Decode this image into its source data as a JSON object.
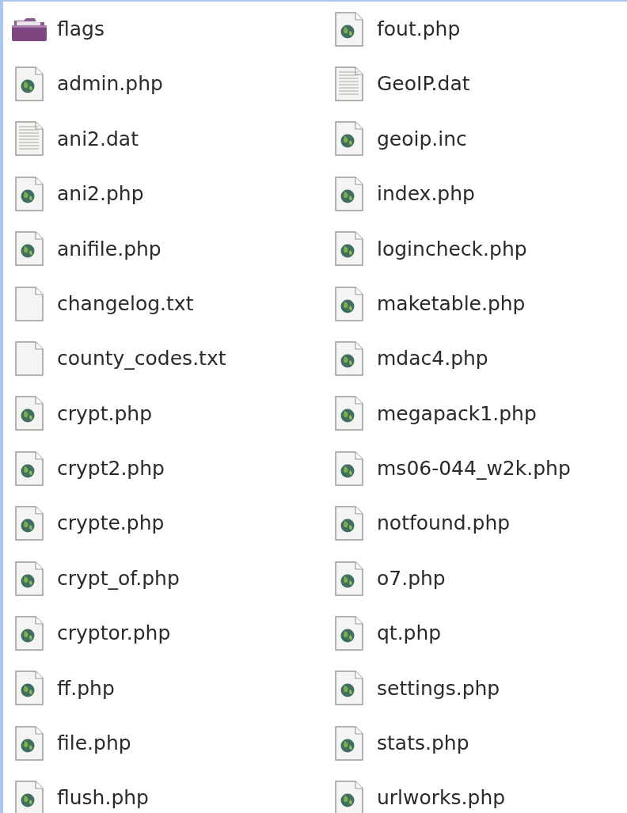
{
  "files": [
    {
      "name": "flags",
      "kind": "folder"
    },
    {
      "name": "admin.php",
      "kind": "php"
    },
    {
      "name": "ani2.dat",
      "kind": "dat"
    },
    {
      "name": "ani2.php",
      "kind": "php"
    },
    {
      "name": "anifile.php",
      "kind": "php"
    },
    {
      "name": "changelog.txt",
      "kind": "txt"
    },
    {
      "name": "county_codes.txt",
      "kind": "txt"
    },
    {
      "name": "crypt.php",
      "kind": "php"
    },
    {
      "name": "crypt2.php",
      "kind": "php"
    },
    {
      "name": "crypte.php",
      "kind": "php"
    },
    {
      "name": "crypt_of.php",
      "kind": "php"
    },
    {
      "name": "cryptor.php",
      "kind": "php"
    },
    {
      "name": "ff.php",
      "kind": "php"
    },
    {
      "name": "file.php",
      "kind": "php"
    },
    {
      "name": "flush.php",
      "kind": "php"
    },
    {
      "name": "fout.php",
      "kind": "php"
    },
    {
      "name": "GeoIP.dat",
      "kind": "dat"
    },
    {
      "name": "geoip.inc",
      "kind": "php"
    },
    {
      "name": "index.php",
      "kind": "php"
    },
    {
      "name": "logincheck.php",
      "kind": "php"
    },
    {
      "name": "maketable.php",
      "kind": "php"
    },
    {
      "name": "mdac4.php",
      "kind": "php"
    },
    {
      "name": "megapack1.php",
      "kind": "php"
    },
    {
      "name": "ms06-044_w2k.php",
      "kind": "php"
    },
    {
      "name": "notfound.php",
      "kind": "php"
    },
    {
      "name": "o7.php",
      "kind": "php"
    },
    {
      "name": "qt.php",
      "kind": "php"
    },
    {
      "name": "settings.php",
      "kind": "php"
    },
    {
      "name": "stats.php",
      "kind": "php"
    },
    {
      "name": "urlworks.php",
      "kind": "php"
    }
  ]
}
